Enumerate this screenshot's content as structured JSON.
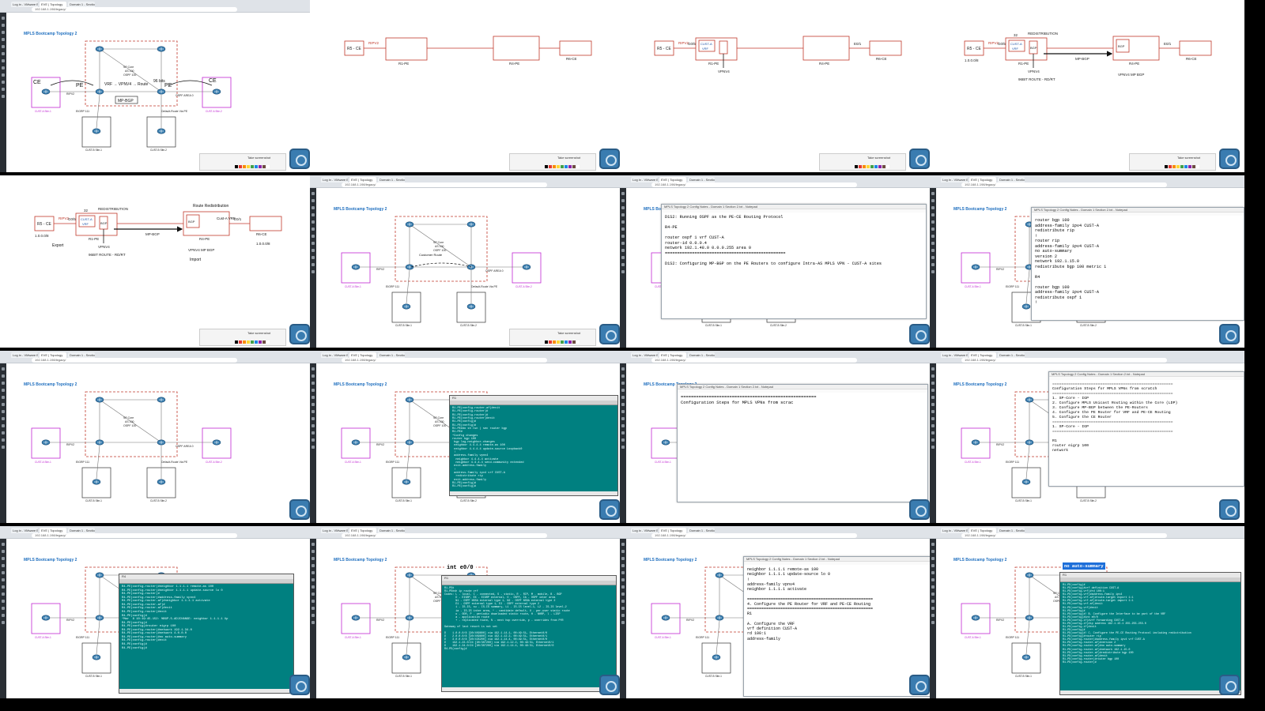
{
  "browser": {
    "tabs": [
      "Log in - VMware ESXi",
      "EVE | Topology",
      "Domain 1 - Section 1 - Google"
    ],
    "url": "192.168.1.198/legacy/"
  },
  "topology": {
    "title": "MPLS Bootcamp Topology 2",
    "core_label": "SP Core",
    "core_label2": "AS 100",
    "core_label3": "OSPF 100",
    "ripv2": "RIPV2",
    "eigrp": "EIGRP 111",
    "ospf_area": "OSPF AREA 0",
    "default_route": "Default-Route Via PE",
    "cust_a_site1": "CUST-A Site-1",
    "cust_a_site2": "CUST-A Site-2",
    "cust_b_site1": "CUST-B Site-1",
    "cust_b_site2": "CUST-B Site-2"
  },
  "annotations": {
    "pe": "PE",
    "ce": "CE",
    "vrf": "VRF",
    "vpnv4": "VPNV4",
    "route": "Route",
    "bits": "96 bits",
    "mp_bgp": "MP-BGP",
    "customer_route": "Customer Route",
    "route_redistribution": "Route Redistribution",
    "ip_route": "1.0.0.0/8",
    "cust_ovrf": "Cust-A VRF",
    "same_rd": "RD SP same"
  },
  "whiteboard": {
    "r5_ce": "R5 - CE",
    "ripv2": "RIPV2",
    "r1_pe": "R1-PE",
    "r4_pe": "R4-PE",
    "r6_ce": "R6-CE",
    "g05": "G0/5",
    "cust_a": "CUST-A",
    "vrf": "VRF",
    "vpnv4": "VPNV4",
    "e01": "E0/1",
    "redistribution": "REDISTRIBUTION",
    "num32": "32",
    "bgp": "BGP",
    "mp_bgp": "MP-BGP",
    "route_96": "96BIT ROUTE - RD/RT",
    "net": "1.0.0.0/8",
    "vpnv4_mpbgp": "VPNV4 MP BGP",
    "take_screenshot": "Take screenshot",
    "export": "Export",
    "import": "Import"
  },
  "notepad_d1s2": {
    "title": "MPLS Topology 2 Config Notes - Domain 1 Section 2.txt - Notepad",
    "lines": [
      "D1S2: Running OSPF as the PE-CE Routing Protocol",
      "",
      "R4-PE",
      "",
      "router ospf 1 vrf CUST-A",
      "router-id 0.0.0.4",
      "network 192.1.48.0 0.0.0.255 area 0",
      "=================================================",
      "",
      "D1S2: Configuring MP-BGP on the PE Routers to configure Intra-AS MPLS VPN - CUST-A sites"
    ]
  },
  "notepad_bgp": {
    "title": "MPLS Topology 2 Config Notes - Domain 1 Section 2.txt - Notepad",
    "lines": [
      "router bgp 100",
      "address-family ipv4 CUST-A",
      "redistribute rip",
      "!",
      "router rip",
      "address-family ipv4 CUST-A",
      "no auto-summary",
      "version 2",
      "network 192.1.15.0",
      "redistribute bgp 100 metric 1",
      "",
      "R4",
      "",
      "router bgp 100",
      "address-family ipv4 CUST-A",
      "redistribute ospf 1",
      "!"
    ]
  },
  "notepad_steps": {
    "title": "MPLS Topology 2 Config Notes - Domain 1 Section 2.txt - Notepad",
    "lines": [
      "=====================================================",
      "Configuration Steps for MPLS VPNs from scrac"
    ]
  },
  "notepad_steps_full": {
    "title": "MPLS Topology 2 Config Notes - Domain 1 Section 2.txt - Notepad",
    "lines": [
      "=====================================================",
      "Configuration Steps for MPLS VPNs from scratch",
      "=====================================================",
      "1. SP-Core - IGP",
      "2. Configure MPLS Unicast Routing within the Core (LDP)",
      "3. Configure MP-BGP between the PE-Routers",
      "4. Configure the PE Router for VRF and PE-CE Routing",
      "5. Configure the CE Router",
      "=====================================================",
      "1. SP-Core - IGP",
      "=====================================================",
      "",
      "R1",
      "router eigrp 100",
      "network"
    ]
  },
  "notepad_vrf": {
    "title": "MPLS Topology 2 Config Notes - Domain 1 Section 2.txt - Notepad",
    "lines": [
      "neighbor 1.1.1.1 remote-as 100",
      "neighbor 1.1.1.1 update-source lo 0",
      "!",
      "address-family vpnv4",
      "neighbor 1.1.1.1 activate",
      "",
      "=====================================================",
      "4. Configure the PE Router for VRF and PE-CE Routing",
      "=====================================================",
      "R1",
      "",
      "A. Configure the VRF",
      "vrf definition CUST-A",
      "rd 100:1",
      "address-family"
    ]
  },
  "notepad_autosum": {
    "highlight": "no auto-summary"
  },
  "terminal_r1": {
    "title": "R1",
    "lines": [
      "R1-PE(config-router-af)#exit",
      "R1-PE(config-router)#",
      "R1-PE(config-router)#",
      "R1-PE(config-router)#exit",
      "R1-PE(config)#",
      "R1-PE(config)#",
      "R1-PE#do sh run | sec router bgp",
      "R1-PE#",
      "*Config changes",
      "router bgp 100",
      " bgp log-neighbor-changes",
      " neighbor 4.4.4.4 remote-as 100",
      " neighbor 4.4.4.4 update-source Loopback0",
      " !",
      " address-family vpnv4",
      "  neighbor 4.4.4.4 activate",
      "  neighbor 4.4.4.4 send-community extended",
      " exit-address-family",
      " !",
      " address-family ipv4 vrf CUST-A",
      "  redistribute rip",
      " exit-address-family",
      "R1-PE(config)#",
      "R1-PE(config)#"
    ]
  },
  "terminal_r4": {
    "title": "R4",
    "lines": [
      "R4-PE(config-router)#neighbor 1.1.1.1 remote-as 100",
      "R4-PE(config-router)#neighbor 1.1.1.1 update-source lo 0",
      "R4-PE(config-router)#",
      "R4-PE(config-router)#address-family vpnv4",
      "R4-PE(config-router-af)#neighbor 1.1.1.1 activate",
      "R4-PE(config-router-af)#",
      "R4-PE(config-router-af)#exit",
      "R4-PE(config-router)#exit",
      "R4-PE(config)#",
      "*Mar  8 10:19:45.152: %BGP-5-ADJCHANGE: neighbor 1.1.1.1 Up",
      "R4-PE(config)#",
      "R4-PE(config)#router eigrp 100",
      "R4-PE(config-router)#network 192.1.34.0",
      "R4-PE(config-router)#network 4.0.0.0",
      "R4-PE(config-router)#no auto-summary",
      "R4-PE(config-router)#exit",
      "R4-PE(config)#",
      "R4-PE(config)#"
    ]
  },
  "terminal_route": {
    "title": "R1",
    "cmd_top": "int e0/0",
    "lines": [
      "R1-PE#",
      "R1-PE#sh ip route vrf",
      "Codes: L - local, C - connected, S - static, R - RIP, M - mobile, B - BGP",
      "       D - EIGRP, EX - EIGRP external, O - OSPF, IA - OSPF inter area",
      "       N1 - OSPF NSSA external type 1, N2 - OSPF NSSA external type 2",
      "       E1 - OSPF external type 1, E2 - OSPF external type 2",
      "       i - IS-IS, su - IS-IS summary, L1 - IS-IS level-1, L2 - IS-IS level-2",
      "       ia - IS-IS inter area, * - candidate default, U - per-user static route",
      "       o - ODR, P - periodic downloaded static route, H - NHRP, l - LISP",
      "       a - application route",
      "       + - replicated route, % - next hop override, p - overrides from PfR",
      "",
      "Gateway of last resort is not set",
      "",
      "D    1.0.0.0/8 [90/409600] via 192.1.14.1, 00:49:51, Ethernet0/0",
      "D    2.0.0.0/8 [90/409600] via 192.1.12.2, 00:49:51, Ethernet0/1",
      "D    3.0.0.0/8 [90/435200] via 192.1.14.4, 00:49:51, Ethernet0/0",
      "D    192.1.23.0/24 [90/307200] via 192.1.12.2, 00:49:51, Ethernet0/1",
      "D    192.1.34.0/24 [90/307200] via 192.1.14.4, 00:49:51, Ethernet0/0",
      "R4-PE(config)#"
    ]
  },
  "terminal_vrfcfg": {
    "title": "R1",
    "lines": [
      "R1-PE(config)#",
      "R1-PE(config)#vrf definition CUST-A",
      "R1-PE(config-vrf)#rd 100:1",
      "R1-PE(config-vrf)#address-family ipv4",
      "R1-PE(config-vrf-af)#route-target export 1:1",
      "R1-PE(config-vrf-af)#route-target import 1:1",
      "R1-PE(config-vrf-af)#exit",
      "R1-PE(config-vrf)#exit",
      "R1-PE(config)#",
      "R1-PE(config)#! B. Configure the Interface to be part of the VRF",
      "R1-PE(config)#int e0/0",
      "R1-PE(config-if)#vrf forwarding CUST-A",
      "R1-PE(config-if)#ip address 192.1.15.1 255.255.255.0",
      "R1-PE(config-if)#exit",
      "R1-PE(config)#",
      "R1-PE(config)#! C. Configure the PE-CE Routing Protocol including redistribution",
      "R1-PE(config)#router rip",
      "R1-PE(config-router)#address-family ipv4 vrf CUST-A",
      "R1-PE(config-router-af)#version 2",
      "R1-PE(config-router-af)#no auto-summary",
      "R1-PE(config-router-af)#network 192.1.15.0",
      "R1-PE(config-router-af)#redistribute bgp 100",
      "R1-PE(config-router-af)#exit",
      "R1-PE(config-router)#router bgp 100",
      "R1-PE(config-router)#"
    ]
  },
  "colors": {
    "accent": "#1f6fbf",
    "red": "#c0392b",
    "magenta": "#c026d3",
    "terminal": "#008080",
    "router": "#3b7fb0"
  }
}
